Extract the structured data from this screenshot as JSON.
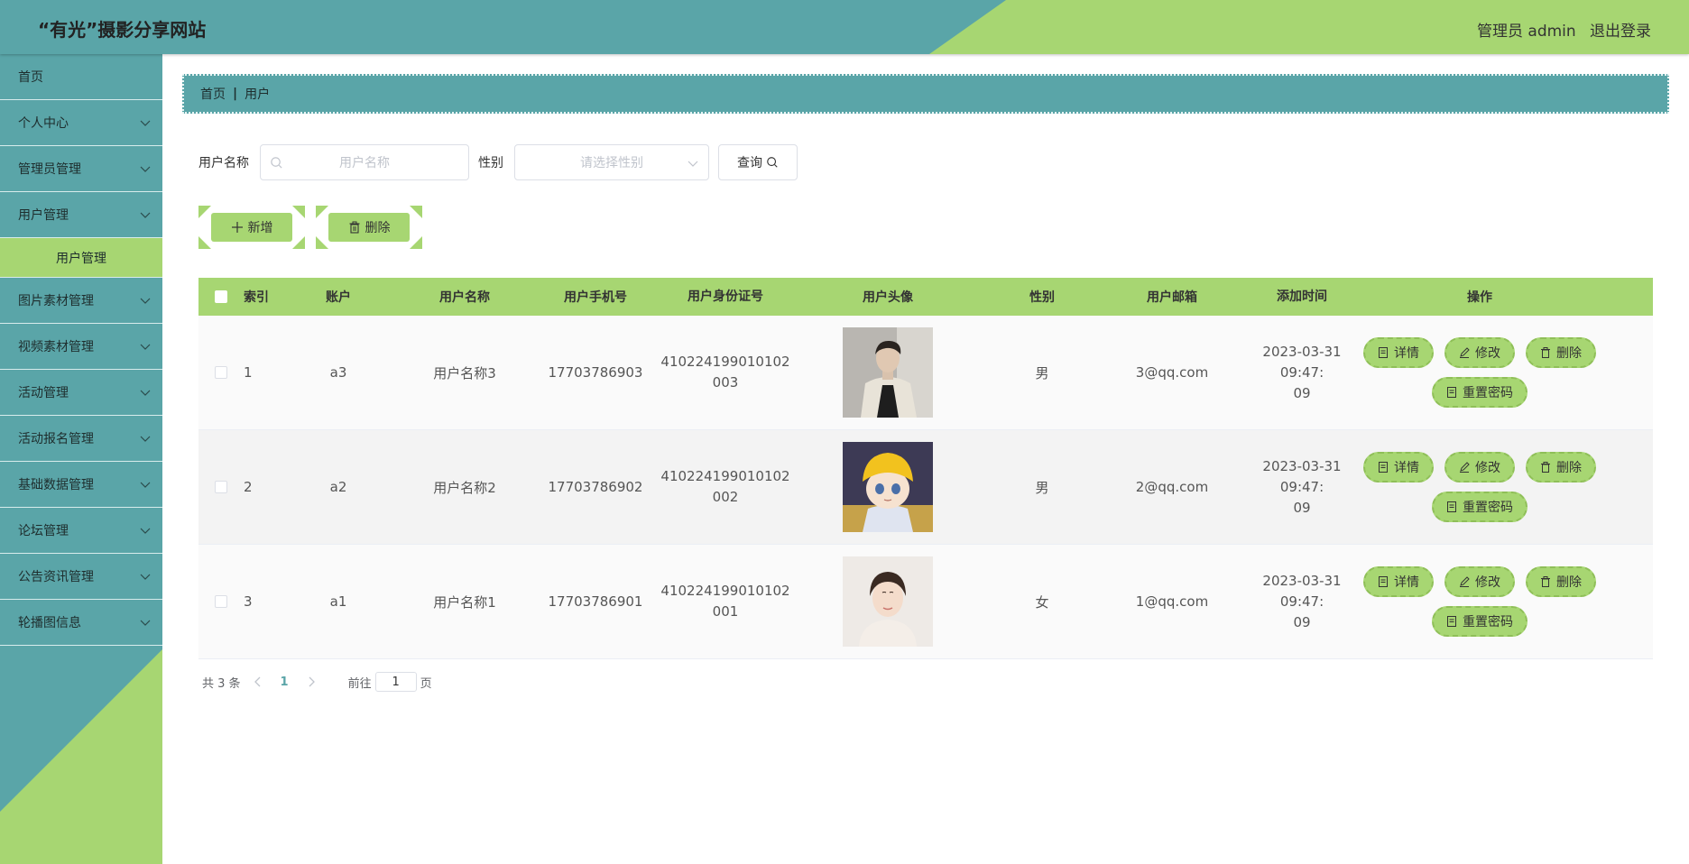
{
  "header": {
    "title": "“有光”摄影分享网站",
    "user_label": "管理员 admin",
    "logout_label": "退出登录",
    "colors": {
      "teal": "#5aa5a8",
      "green": "#a7d672"
    }
  },
  "sidebar": {
    "items": [
      {
        "label": "首页",
        "has_chevron": false
      },
      {
        "label": "个人中心",
        "has_chevron": true
      },
      {
        "label": "管理员管理",
        "has_chevron": true
      },
      {
        "label": "用户管理",
        "has_chevron": true,
        "expanded": true
      },
      {
        "label": "图片素材管理",
        "has_chevron": true
      },
      {
        "label": "视频素材管理",
        "has_chevron": true
      },
      {
        "label": "活动管理",
        "has_chevron": true
      },
      {
        "label": "活动报名管理",
        "has_chevron": true
      },
      {
        "label": "基础数据管理",
        "has_chevron": true
      },
      {
        "label": "论坛管理",
        "has_chevron": true
      },
      {
        "label": "公告资讯管理",
        "has_chevron": true
      },
      {
        "label": "轮播图信息",
        "has_chevron": true
      }
    ],
    "sub_item": {
      "label": "用户管理",
      "active": true
    }
  },
  "breadcrumb": {
    "home": "首页",
    "sep": "|",
    "current": "用户"
  },
  "search": {
    "name_label": "用户名称",
    "name_placeholder": "用户名称",
    "sex_label": "性别",
    "sex_placeholder": "请选择性别",
    "query_label": "查询"
  },
  "actions": {
    "add_label": "新增",
    "delete_label": "删除"
  },
  "table": {
    "headers": [
      "索引",
      "账户",
      "用户名称",
      "用户手机号",
      "用户身份证号",
      "用户头像",
      "性别",
      "用户邮箱",
      "添加时间",
      "操作"
    ],
    "rows": [
      {
        "index": "1",
        "account": "a3",
        "name": "用户名称3",
        "phone": "17703786903",
        "id_line1": "410224199010102",
        "id_line2": "003",
        "avatar": "portrait-man-coat",
        "sex": "男",
        "email": "3@qq.com",
        "time_line1": "2023-03-31 09:47:",
        "time_line2": "09"
      },
      {
        "index": "2",
        "account": "a2",
        "name": "用户名称2",
        "phone": "17703786902",
        "id_line1": "410224199010102",
        "id_line2": "002",
        "avatar": "cartoon-boy-yellow-hat",
        "sex": "男",
        "email": "2@qq.com",
        "time_line1": "2023-03-31 09:47:",
        "time_line2": "09"
      },
      {
        "index": "3",
        "account": "a1",
        "name": "用户名称1",
        "phone": "17703786901",
        "id_line1": "410224199010102",
        "id_line2": "001",
        "avatar": "portrait-woman",
        "sex": "女",
        "email": "1@qq.com",
        "time_line1": "2023-03-31 09:47:",
        "time_line2": "09"
      }
    ],
    "ops": {
      "detail": "详情",
      "edit": "修改",
      "delete": "删除",
      "reset": "重置密码"
    }
  },
  "pagination": {
    "total": "共 3 条",
    "current_page": "1",
    "goto_label": "前往",
    "goto_value": "1",
    "page_suffix": "页"
  }
}
